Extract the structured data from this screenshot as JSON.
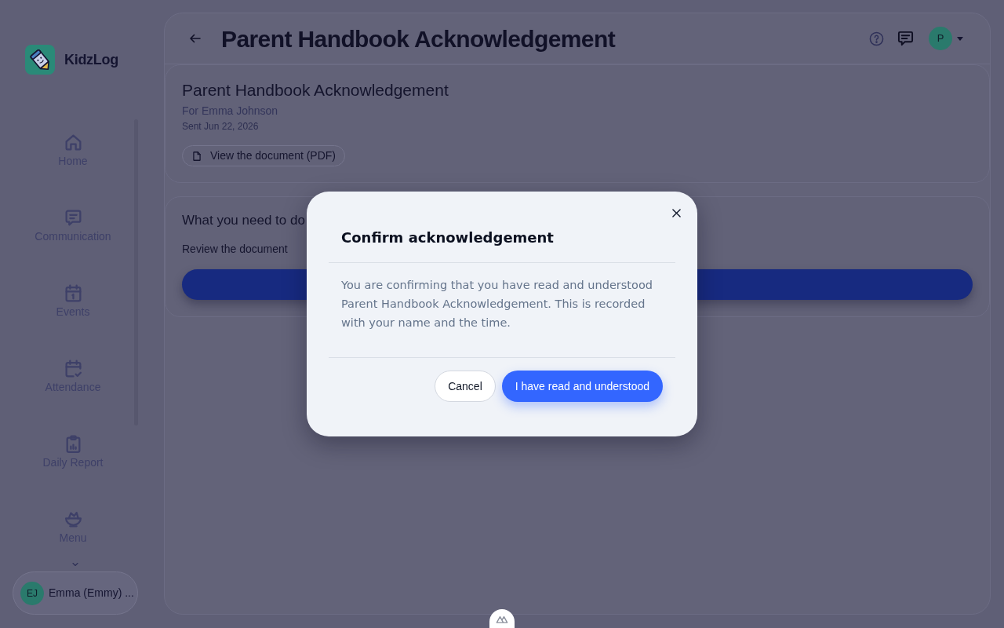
{
  "sidebar": {
    "brand": "KidzLog",
    "nav_items": [
      {
        "label": "Home",
        "selected": false
      },
      {
        "label": "Communication",
        "selected": false
      },
      {
        "label": "Events",
        "selected": false
      },
      {
        "label": "Attendance",
        "selected": false
      },
      {
        "label": "Daily Report",
        "selected": false
      },
      {
        "label": "Menu",
        "selected": false
      }
    ],
    "user": {
      "initials": "EJ",
      "name": "Emma (Emmy) ..."
    }
  },
  "header": {
    "title": "Parent Handbook Acknowledgement",
    "avatar": "P"
  },
  "document_card": {
    "title": "Parent Handbook Acknowledgement",
    "recipient": "For Emma Johnson",
    "sent": "Sent Jun 22, 2026",
    "view_button": "View the document (PDF)"
  },
  "task_card": {
    "title": "What you need to do",
    "step": "Review the document"
  },
  "dialog": {
    "title": "Confirm acknowledgement",
    "message": "You are confirming that you have read and understood Parent Handbook Acknowledgement. This is recorded with your name and the time.",
    "buttons": [
      {
        "label": "Cancel",
        "kind": "secondary"
      },
      {
        "label": "I have read and understood",
        "kind": "primary"
      }
    ]
  }
}
